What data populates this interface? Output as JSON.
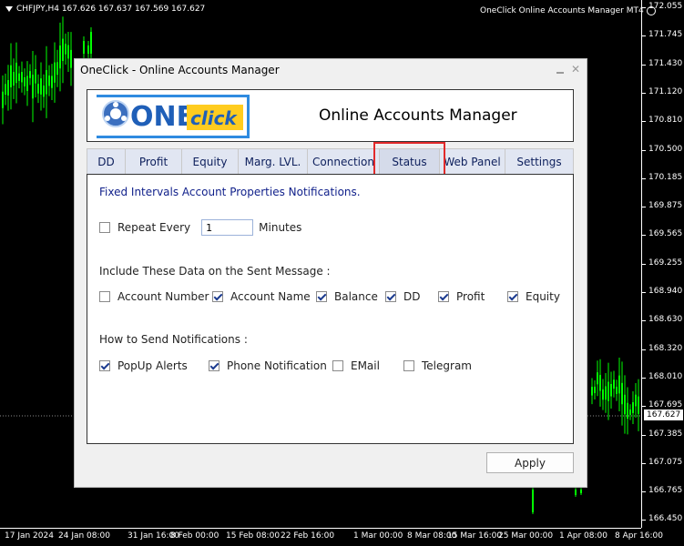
{
  "chart": {
    "symbol_info": "CHFJPY,H4  167.626 167.637 167.569 167.627",
    "ea_label": "OneClick Online Accounts Manager MT4",
    "price_labels": [
      "172.055",
      "171.745",
      "171.430",
      "171.120",
      "170.810",
      "170.500",
      "170.185",
      "169.875",
      "169.565",
      "169.255",
      "168.940",
      "168.630",
      "168.320",
      "168.010",
      "167.695",
      "167.385",
      "167.075",
      "166.765",
      "166.450"
    ],
    "current_price": "167.627",
    "time_labels": [
      "17 Jan 2024",
      "24 Jan 08:00",
      "31 Jan 16:00",
      "8 Feb 00:00",
      "15 Feb 08:00",
      "22 Feb 16:00",
      "1 Mar 00:00",
      "8 Mar 08:00",
      "15 Mar 16:00",
      "25 Mar 00:00",
      "1 Apr 08:00",
      "8 Apr 16:00"
    ],
    "candle_color": "#00ff00"
  },
  "dialog": {
    "title": "OneClick - Online Accounts Manager",
    "minimize_icon": "minimize-icon",
    "close_symbol": "✕",
    "logo_text_one": "ONE",
    "logo_text_click": "click",
    "header_title": "Online Accounts Manager",
    "tabs": [
      {
        "label": "DD"
      },
      {
        "label": "Profit"
      },
      {
        "label": "Equity"
      },
      {
        "label": "Marg. LVL."
      },
      {
        "label": "Connection"
      },
      {
        "label": "Status"
      },
      {
        "label": "Web Panel"
      },
      {
        "label": "Settings"
      }
    ],
    "active_tab": "Status",
    "panel": {
      "title": "Fixed Intervals Account Properties Notifications.",
      "repeat": {
        "label": "Repeat Every",
        "value": "1",
        "unit": "Minutes",
        "checked": false
      },
      "data_section_label": "Include These Data on the Sent Message :",
      "data_items": [
        {
          "label": "Account Number",
          "checked": false
        },
        {
          "label": "Account Name",
          "checked": true
        },
        {
          "label": "Balance",
          "checked": true
        },
        {
          "label": "DD",
          "checked": true
        },
        {
          "label": "Profit",
          "checked": true
        },
        {
          "label": "Equity",
          "checked": true
        }
      ],
      "send_section_label": "How to Send Notifications :",
      "send_items": [
        {
          "label": "PopUp Alerts",
          "checked": true
        },
        {
          "label": "Phone Notification",
          "checked": true
        },
        {
          "label": "EMail",
          "checked": false
        },
        {
          "label": "Telegram",
          "checked": false
        }
      ]
    },
    "apply_label": "Apply",
    "colors": {
      "tab_text": "#0d1f5c",
      "panel_title": "#0f1f8a",
      "highlight": "#e22a2a"
    }
  }
}
